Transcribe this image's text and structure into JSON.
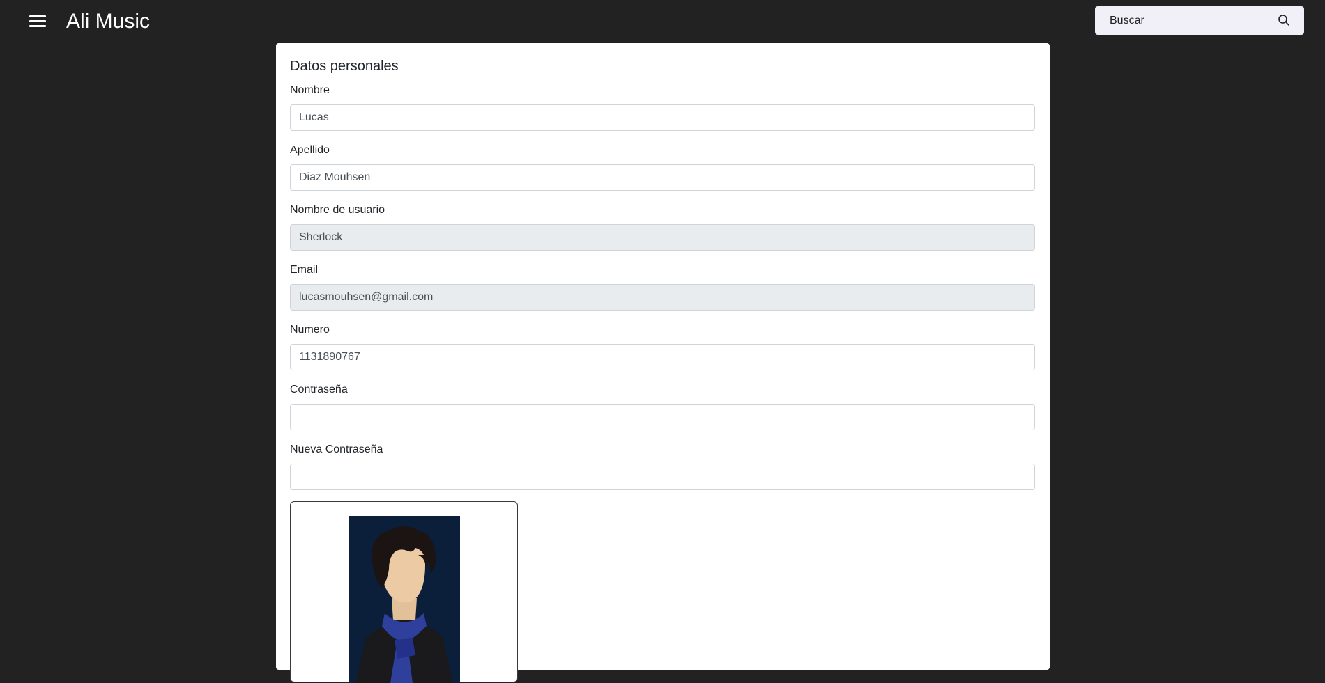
{
  "header": {
    "app_title": "Ali Music",
    "search_placeholder": "Buscar",
    "menu_icon": "hamburger-menu-icon",
    "search_icon": "search-icon"
  },
  "colors": {
    "page_background": "#222222",
    "card_background": "#ffffff",
    "search_background": "#f1eff8",
    "disabled_input": "#e9ecef"
  },
  "form": {
    "title": "Datos personales",
    "fields": [
      {
        "label": "Nombre",
        "value": "Lucas",
        "disabled": false
      },
      {
        "label": "Apellido",
        "value": "Diaz Mouhsen",
        "disabled": false
      },
      {
        "label": "Nombre de usuario",
        "value": "Sherlock",
        "disabled": true
      },
      {
        "label": "Email",
        "value": "lucasmouhsen@gmail.com",
        "disabled": true
      },
      {
        "label": "Numero",
        "value": "1131890767",
        "disabled": false
      },
      {
        "label": "Contraseña",
        "value": "",
        "disabled": false
      },
      {
        "label": "Nueva Contraseña",
        "value": "",
        "disabled": false
      }
    ]
  },
  "profile_image": {
    "description_icon": "avatar-sherlock-illustration"
  }
}
